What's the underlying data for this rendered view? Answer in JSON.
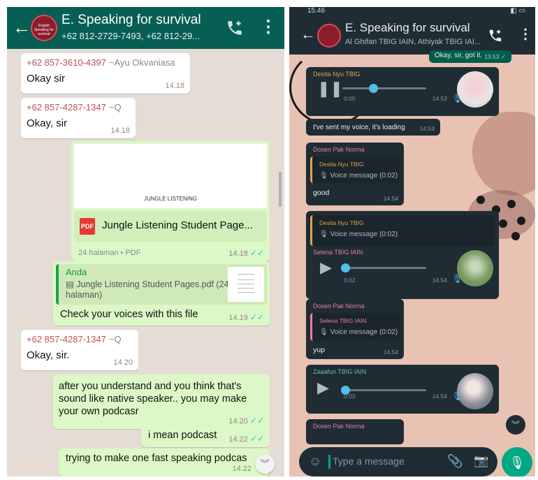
{
  "left": {
    "header": {
      "title": "E. Speaking for survival",
      "subtitle": "+62 812-2729-7493, +62 812-29...",
      "avatar_text": "English Speaking for survival"
    },
    "messages": [
      {
        "sender": "+62 857-3610-4397",
        "sender_name": "~Ayu Okvaniasa",
        "text": "Okay sir",
        "time": "14.18"
      },
      {
        "sender": "+62 857-4287-1347",
        "sender_name": "~Q",
        "text": "Okay, sir",
        "time": "14.18"
      },
      {
        "preview_title": "JUNGLE LISTENING",
        "file_icon": "PDF",
        "file_name": "Jungle Listening Student Page...",
        "meta": "24 halaman • PDF",
        "time": "14.18",
        "ticks": "✓✓"
      },
      {
        "quote_who": "Anda",
        "quote_text": "▤ Jungle Listening Student Pages.pdf (24 halaman)",
        "text": "Check your voices with this file",
        "time": "14.19",
        "ticks": "✓✓"
      },
      {
        "sender": "+62 857-4287-1347",
        "sender_name": "~Q",
        "text": "Okay, sir.",
        "time": "14.20"
      },
      {
        "text": "after you understand and you think that's sound like native speaker.. you may make your own podcasr",
        "time": "14.20",
        "ticks": "✓✓"
      },
      {
        "text": "i mean podcast",
        "time": "14.22",
        "ticks": "✓✓"
      },
      {
        "text": "trying to make one fast speaking podcas",
        "time": "14.22"
      }
    ]
  },
  "right": {
    "status_bar": {
      "time": "15.46",
      "right": "◧ ▭"
    },
    "header": {
      "title": "E. Speaking for survival",
      "subtitle": "Al Ghifari TBIG IAIN, Athiyak TBIG IAI..."
    },
    "messages": [
      {
        "text": "Okay, sir, got it.",
        "time": "13.53 ✓"
      },
      {
        "sender": "Desita Nyu TBIG",
        "duration": "0:00",
        "time": "14.53"
      },
      {
        "text": "I've sent my voice, it's loading",
        "time": "14.53"
      },
      {
        "sender": "Dosen Pak Norma",
        "quote_sender": "Desita Nyu TBIG",
        "quote_text": "🎙 Voice message (0:02)",
        "text": "good",
        "time": "14.54"
      },
      {
        "quote_sender": "Desita Nyu TBIG",
        "quote_text": "🎙 Voice message (0:02)",
        "sender": "Selena TBIG IAIN",
        "duration": "0:02",
        "time": "14.54"
      },
      {
        "sender": "Dosen Pak Norma",
        "quote_sender": "Selena TBIG IAIN",
        "quote_text": "🎙 Voice message (0:02)",
        "text": "yup",
        "time": "14.54"
      },
      {
        "sender": "Zaaafun TBIG IAIN",
        "duration": "0:02",
        "time": "14.54"
      },
      {
        "sender": "Dosen Pak Norma"
      }
    ],
    "input": {
      "placeholder": "Type a message"
    }
  },
  "colors": {
    "wa_green": "#075e54",
    "out_bubble": "#dcf8c6",
    "dark_bg": "#1f2c34",
    "accent": "#00a884",
    "tick_blue": "#34b7f1"
  },
  "icons": [
    "back-arrow-icon",
    "add-call-icon",
    "more-vert-icon",
    "pdf-icon",
    "double-check-icon",
    "pause-icon",
    "play-icon",
    "mic-icon",
    "emoji-icon",
    "attach-icon",
    "camera-icon",
    "scroll-down-icon"
  ]
}
